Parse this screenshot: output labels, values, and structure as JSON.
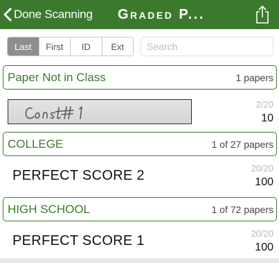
{
  "header": {
    "back_label": "Done Scanning",
    "title": "Graded P...",
    "background_color": "#3b7a2d",
    "back_icon": "chevron-left-icon",
    "share_icon": "share-icon"
  },
  "filter": {
    "segments": [
      "Last",
      "First",
      "ID",
      "Ext"
    ],
    "active_segment": "Last",
    "search_placeholder": "Search",
    "search_value": ""
  },
  "sections": [
    {
      "name": "Paper Not in Class",
      "count": "1 papers",
      "rows": [
        {
          "name_image": "handwritten-name",
          "name_text": "Const#1",
          "raw": "2/20",
          "score": "10"
        }
      ]
    },
    {
      "name": "COLLEGE",
      "count": "1 of 27 papers",
      "rows": [
        {
          "name": "PERFECT SCORE 2",
          "raw": "20/20",
          "score": "100"
        }
      ]
    },
    {
      "name": "HIGH SCHOOL",
      "count": "1 of 72 papers",
      "rows": [
        {
          "name": "PERFECT SCORE 1",
          "raw": "20/20",
          "score": "100"
        }
      ]
    }
  ],
  "colors": {
    "accent": "#3b7a2d",
    "muted_text": "#b8b8b8",
    "segment_active": "#8e8e8e"
  }
}
